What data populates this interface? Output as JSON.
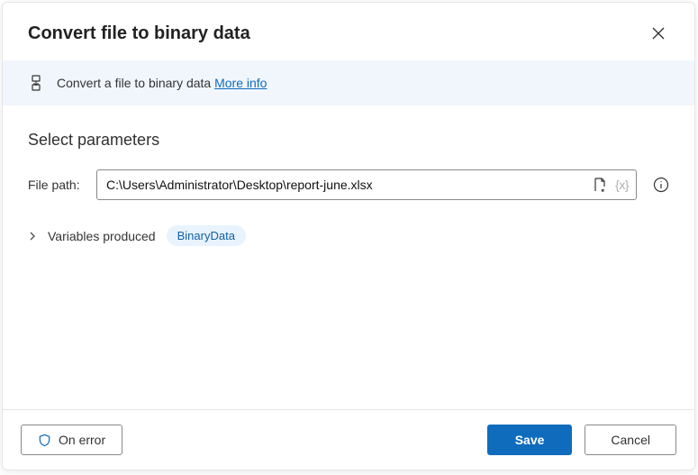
{
  "dialog": {
    "title": "Convert file to binary data"
  },
  "banner": {
    "text": "Convert a file to binary data ",
    "more_info": "More info"
  },
  "params": {
    "section_title": "Select parameters",
    "file_path_label": "File path:",
    "file_path_value": "C:\\Users\\Administrator\\Desktop\\report-june.xlsx",
    "variables_label": "Variables produced",
    "variable_badge": "BinaryData"
  },
  "footer": {
    "on_error": "On error",
    "save": "Save",
    "cancel": "Cancel"
  }
}
